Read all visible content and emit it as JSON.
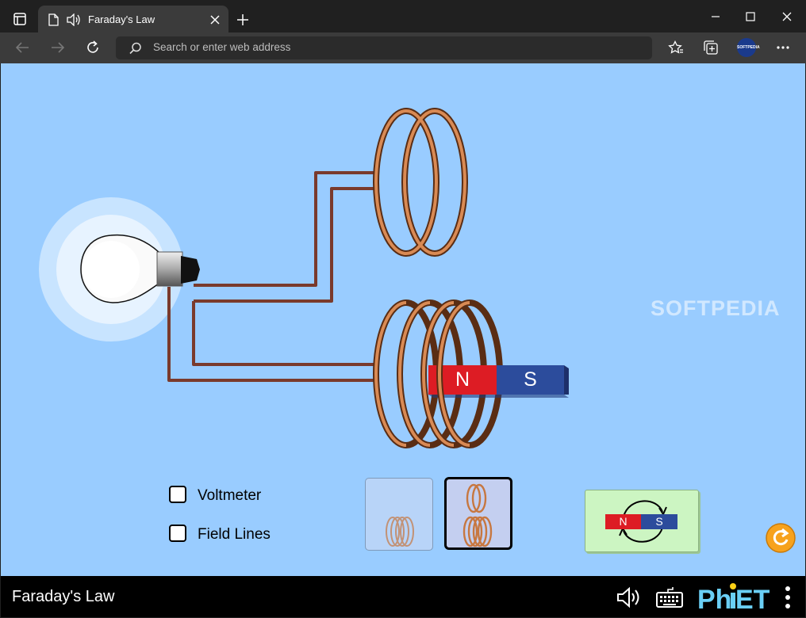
{
  "browser": {
    "tab_title": "Faraday's Law",
    "address_placeholder": "Search or enter web address",
    "avatar_text": "SOFTPEDIA"
  },
  "controls": {
    "voltmeter_label": "Voltmeter",
    "field_lines_label": "Field Lines",
    "voltmeter_checked": false,
    "field_lines_checked": false
  },
  "magnet": {
    "north_label": "N",
    "south_label": "S",
    "north_color": "#dd1c24",
    "south_color": "#2c4c9c"
  },
  "flip_button": {
    "north_label": "N",
    "south_label": "S"
  },
  "coil_selector": {
    "one_coil_selected": false,
    "two_coils_selected": true
  },
  "footer": {
    "sim_title": "Faraday's Law",
    "brand": "PhET"
  },
  "watermark": "SOFTPEDIA",
  "colors": {
    "sim_background": "#99ccff",
    "wire": "#7a3a2c",
    "copper": "#c77740"
  }
}
